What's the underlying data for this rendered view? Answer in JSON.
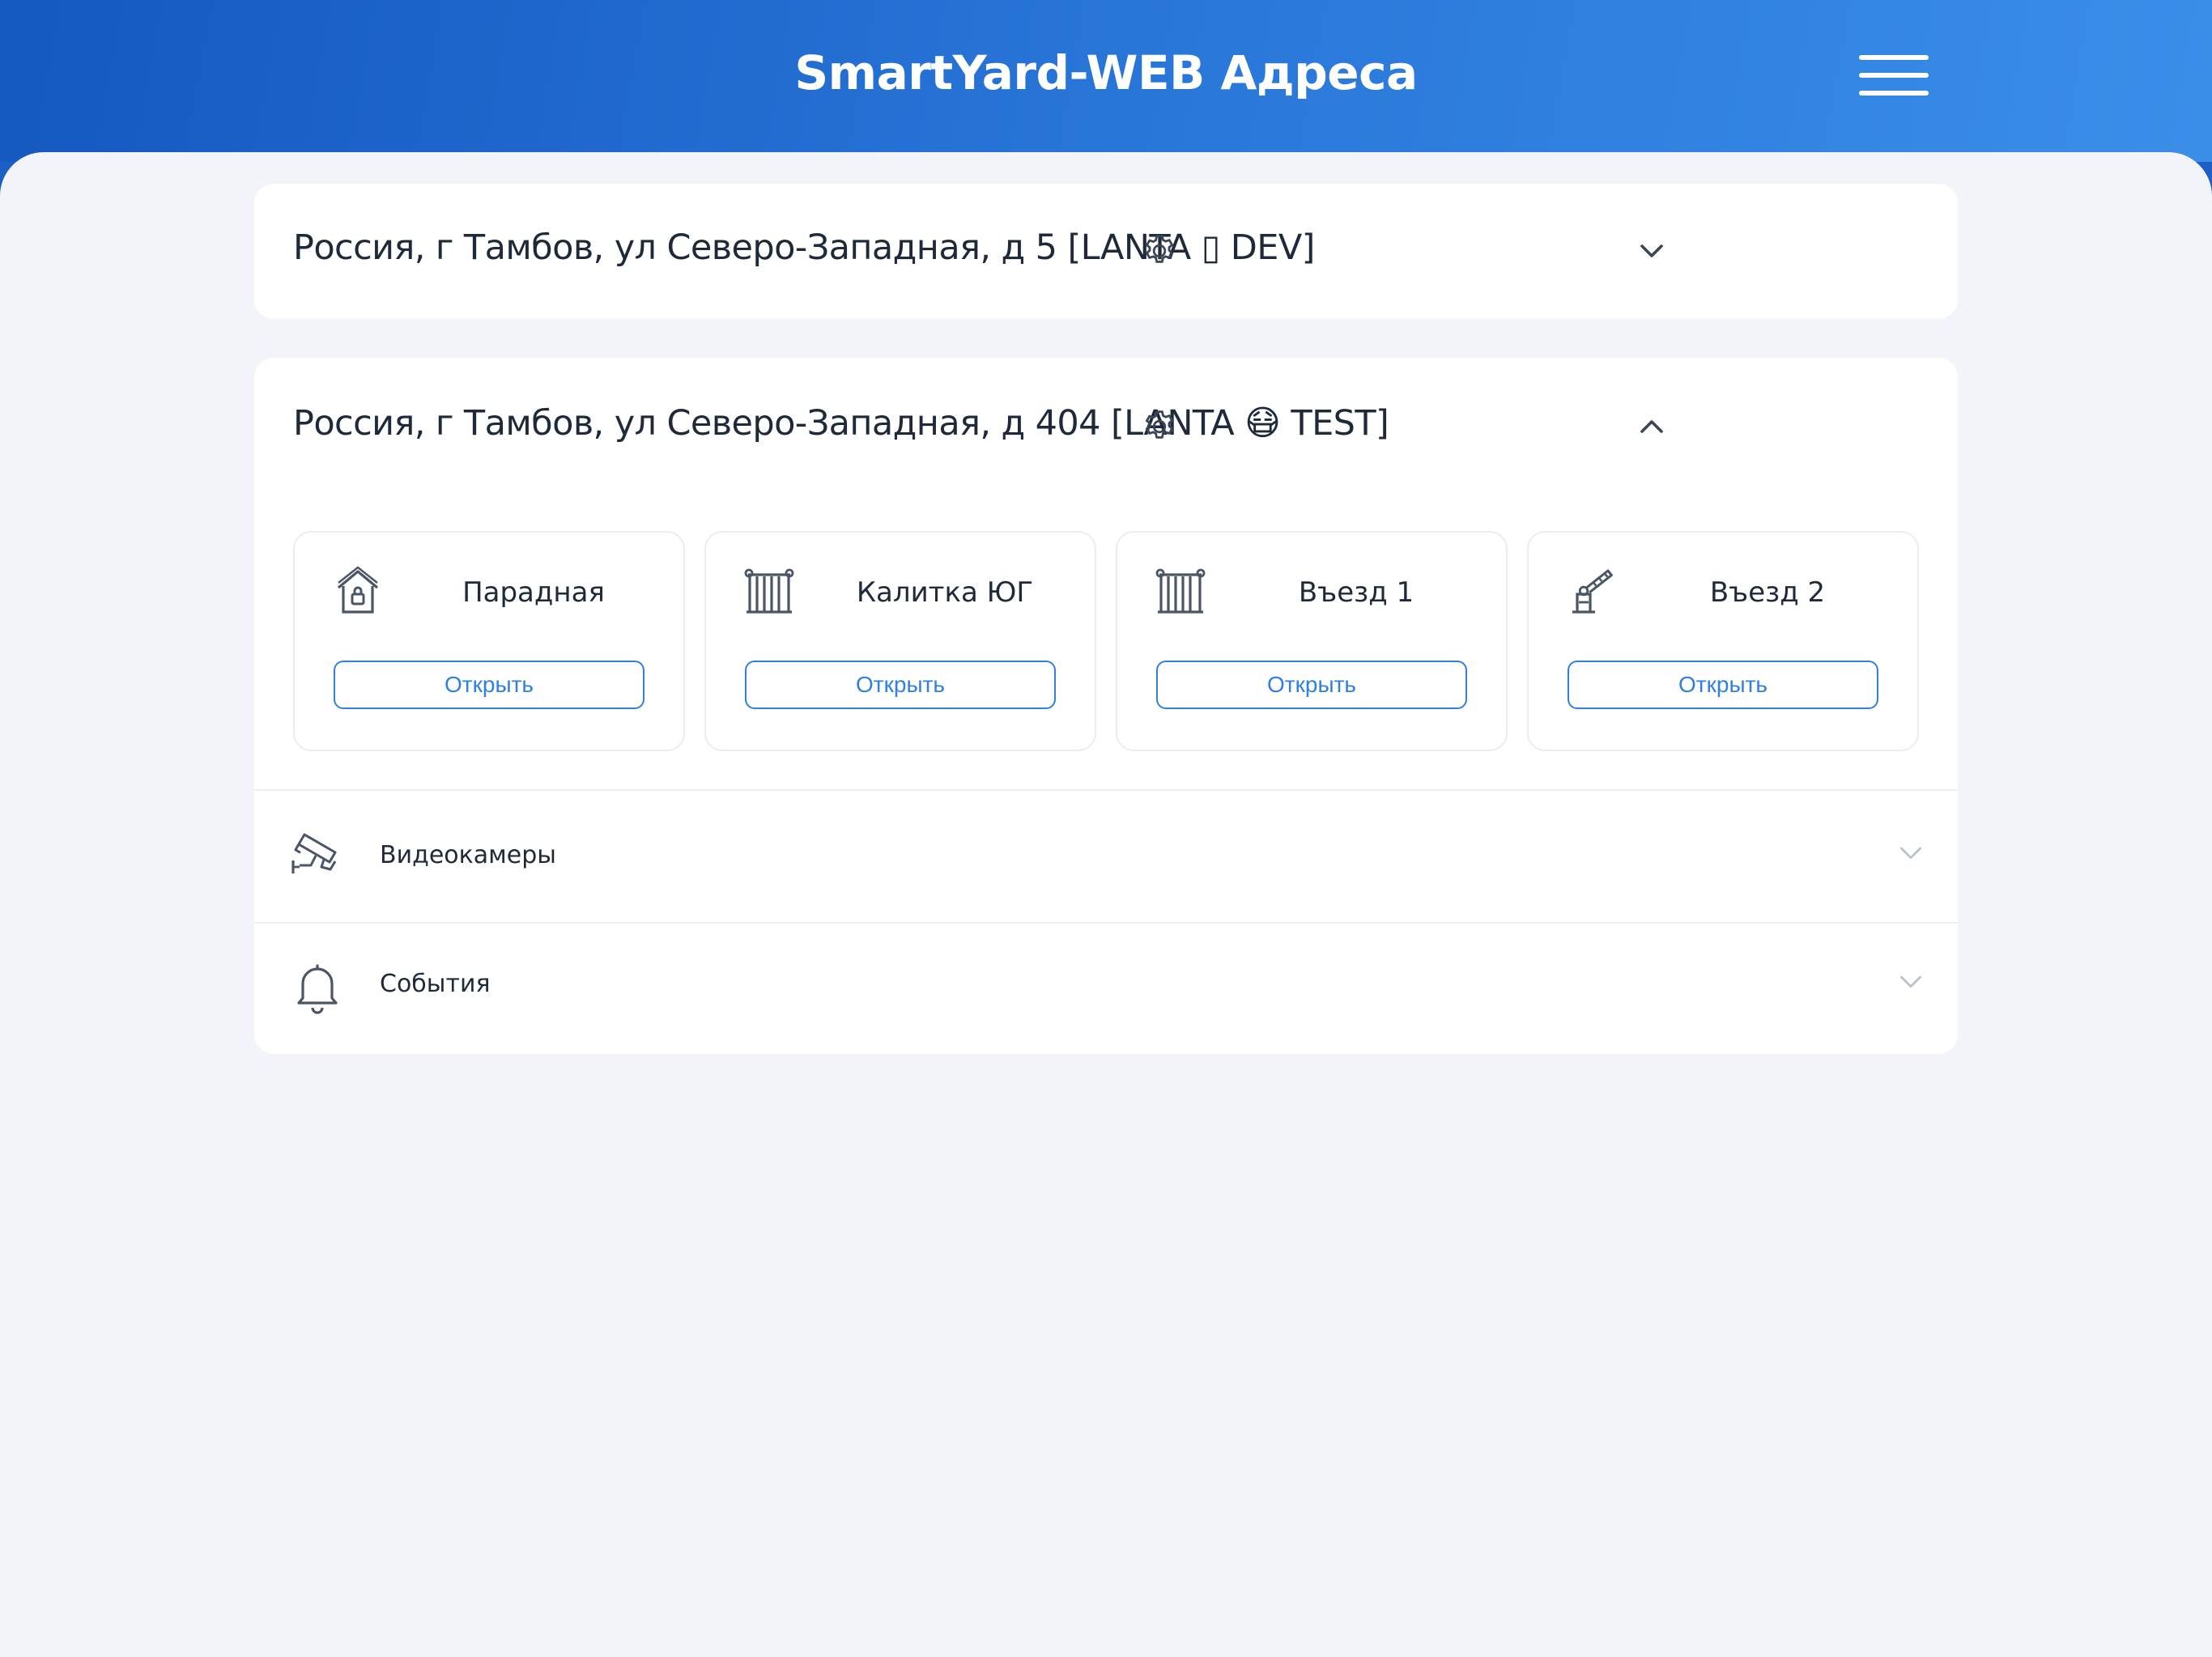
{
  "header": {
    "title": "SmartYard-WEB Адреса",
    "menu_icon": "hamburger-menu-icon"
  },
  "colors": {
    "header_start": "#1558c0",
    "header_end": "#3a8ee8",
    "background": "#f2f4f9",
    "accent": "#2f80e0",
    "text": "#1e2a3a"
  },
  "addresses": [
    {
      "title": "Россия, г Тамбов, ул Северо-Западная, д 5 [LANTA ▯ DEV]",
      "expanded": false,
      "settings_icon": "gear-icon",
      "toggle_icon": "chevron-down-icon"
    },
    {
      "title": "Россия, г Тамбов, ул Северо-Западная, д 404 [LANTA 😷 TEST]",
      "expanded": true,
      "settings_icon": "gear-icon",
      "toggle_icon": "chevron-up-icon",
      "doors": [
        {
          "name": "Парадная",
          "icon": "entrance-house-lock-icon",
          "button": "Открыть"
        },
        {
          "name": "Калитка ЮГ",
          "icon": "gate-icon",
          "button": "Открыть"
        },
        {
          "name": "Въезд 1",
          "icon": "gate-icon",
          "button": "Открыть"
        },
        {
          "name": "Въезд 2",
          "icon": "barrier-icon",
          "button": "Открыть"
        }
      ],
      "sections": [
        {
          "label": "Видеокамеры",
          "icon": "cctv-camera-icon",
          "toggle_icon": "chevron-down-icon"
        },
        {
          "label": "События",
          "icon": "bell-icon",
          "toggle_icon": "chevron-down-icon"
        }
      ]
    }
  ]
}
